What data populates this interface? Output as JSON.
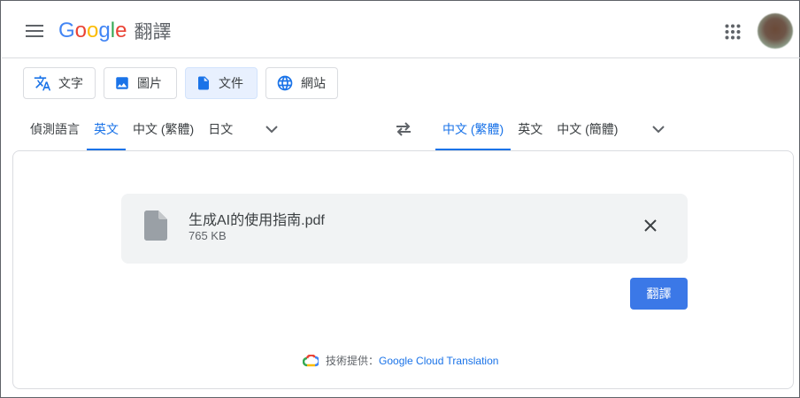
{
  "header": {
    "logo_letters": [
      "G",
      "o",
      "o",
      "g",
      "l",
      "e"
    ],
    "product_name": "翻譯"
  },
  "modes": [
    {
      "label": "文字",
      "icon": "translate-icon",
      "active": false
    },
    {
      "label": "圖片",
      "icon": "image-icon",
      "active": false
    },
    {
      "label": "文件",
      "icon": "document-icon",
      "active": true
    },
    {
      "label": "網站",
      "icon": "globe-icon",
      "active": false
    }
  ],
  "source_languages": [
    "偵測語言",
    "英文",
    "中文 (繁體)",
    "日文"
  ],
  "source_selected": "英文",
  "target_languages": [
    "中文 (繁體)",
    "英文",
    "中文 (簡體)"
  ],
  "target_selected": "中文 (繁體)",
  "file": {
    "name": "生成AI的使用指南.pdf",
    "size": "765 KB"
  },
  "translate_button": "翻譯",
  "footer": {
    "powered_prefix": "技術提供：",
    "powered_link": "Google Cloud Translation"
  },
  "colors": {
    "accent": "#1a73e8",
    "button": "#3b78e7",
    "file_bg": "#f1f3f4"
  }
}
